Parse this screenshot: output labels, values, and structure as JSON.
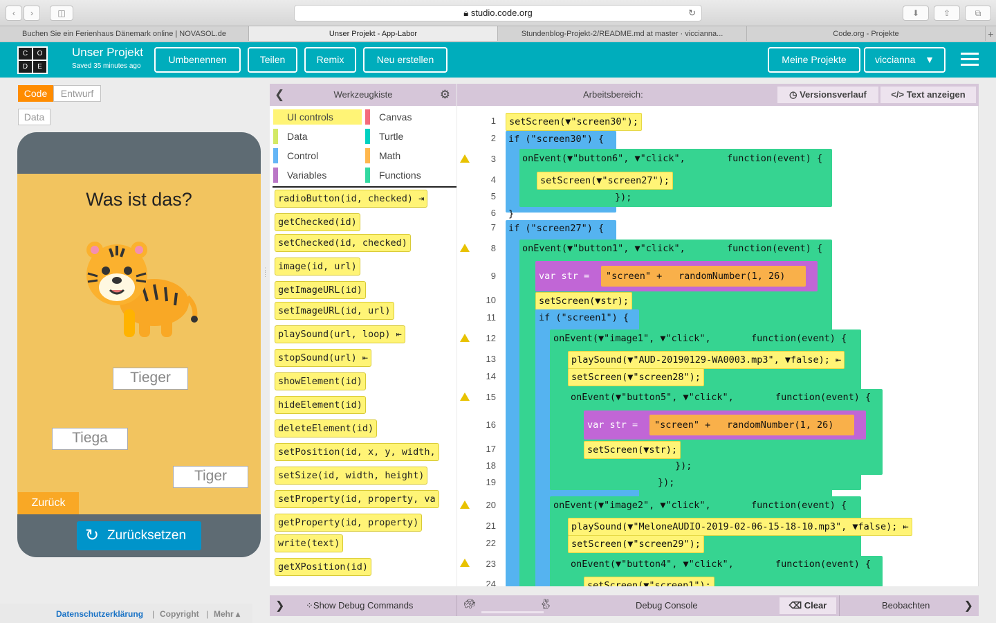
{
  "browser": {
    "url": "studio.code.org",
    "tabs": [
      "Buchen Sie ein Ferienhaus Dänemark online | NOVASOL.de",
      "Unser Projekt - App-Labor",
      "Stundenblog-Projekt-2/README.md at master · viccianna...",
      "Code.org - Projekte"
    ]
  },
  "header": {
    "logo_letters": [
      "C",
      "O",
      "D",
      "E"
    ],
    "project_title": "Unser Projekt",
    "saved_text": "Saved 35 minutes ago",
    "buttons": [
      "Umbenennen",
      "Teilen",
      "Remix",
      "Neu erstellen"
    ],
    "my_projects": "Meine Projekte",
    "user": "viccianna"
  },
  "left": {
    "toggle_code": "Code",
    "toggle_design": "Entwurf",
    "data_button": "Data",
    "question": "Was ist das?",
    "answers": [
      "Tieger",
      "Tiega",
      "Tiger"
    ],
    "back_button": "Zurück",
    "reset_button": "Zurücksetzen"
  },
  "toolbox": {
    "title": "Werkzeugkiste",
    "categories": [
      {
        "label": "UI controls",
        "color": "#fff476"
      },
      {
        "label": "Canvas",
        "color": "#f46a7b"
      },
      {
        "label": "Data",
        "color": "#d3e965"
      },
      {
        "label": "Turtle",
        "color": "#00d1c1"
      },
      {
        "label": "Control",
        "color": "#64b5f6"
      },
      {
        "label": "Math",
        "color": "#ffb74d"
      },
      {
        "label": "Variables",
        "color": "#bb77c7"
      },
      {
        "label": "Functions",
        "color": "#33d9a0"
      }
    ],
    "blocks": [
      "radioButton(id, checked) ⇥",
      "getChecked(id)",
      "setChecked(id, checked)",
      "image(id, url)",
      "getImageURL(id)",
      "setImageURL(id, url)",
      "playSound(url, loop) ⇤",
      "stopSound(url) ⇤",
      "showElement(id)",
      "hideElement(id)",
      "deleteElement(id)",
      "setPosition(id, x, y, width,",
      "setSize(id, width, height)",
      "setProperty(id, property, va",
      "getProperty(id, property)",
      "write(text)",
      "getXPosition(id)"
    ]
  },
  "workspace": {
    "title": "Arbeitsbereich:",
    "version_history": "Versionsverlauf",
    "show_text": "Text anzeigen",
    "line_numbers": [
      "1",
      "2",
      "3",
      "4",
      "5",
      "6",
      "7",
      "8",
      "9",
      "10",
      "11",
      "12",
      "13",
      "14",
      "15",
      "16",
      "17",
      "18",
      "19",
      "20",
      "21",
      "22",
      "23",
      "24"
    ],
    "code": {
      "l1": "setScreen(▼\"screen30\");",
      "l2": "if (\"screen30\") {",
      "l3a": "onEvent(▼\"button6\", ▼\"click\",",
      "l3b": "function(event) {",
      "l4": "setScreen(▼\"screen27\");",
      "l5": "});",
      "l6": "}",
      "l7": "if (\"screen27\") {",
      "l8a": "onEvent(▼\"button1\", ▼\"click\",",
      "l8b": "function(event) {",
      "l9a": "var str =",
      "l9b": "\"screen\" +",
      "l9c": "randomNumber(1, 26)",
      "l10": "setScreen(▼str);",
      "l11": "if (\"screen1\") {",
      "l12a": "onEvent(▼\"image1\", ▼\"click\",",
      "l12b": "function(event) {",
      "l13": "playSound(▼\"AUD-20190129-WA0003.mp3\", ▼false); ⇤",
      "l14": "setScreen(▼\"screen28\");",
      "l15a": "onEvent(▼\"button5\", ▼\"click\",",
      "l15b": "function(event) {",
      "l16a": "var str =",
      "l16b": "\"screen\" +",
      "l16c": "randomNumber(1, 26)",
      "l17": "setScreen(▼str);",
      "l18": "});",
      "l19": "});",
      "l20a": "onEvent(▼\"image2\", ▼\"click\",",
      "l20b": "function(event) {",
      "l21": "playSound(▼\"MeloneAUDIO-2019-02-06-15-18-10.mp3\", ▼false); ⇤",
      "l22": "setScreen(▼\"screen29\");",
      "l23a": "onEvent(▼\"button4\", ▼\"click\",",
      "l23b": "function(event) {",
      "l24": "setScreen(▼\"screen1\");"
    }
  },
  "debug": {
    "show_commands": "Show Debug Commands",
    "console": "Debug Console",
    "clear": "Clear",
    "watch": "Beobachten"
  },
  "footer": {
    "privacy": "Datenschutzerklärung",
    "copyright": "Copyright",
    "more": "Mehr ▴"
  },
  "colors": {
    "header": "#00adbc",
    "accent_orange": "#ff8c00",
    "app_bg": "#f2c45f",
    "reset_blue": "#0094ca"
  }
}
